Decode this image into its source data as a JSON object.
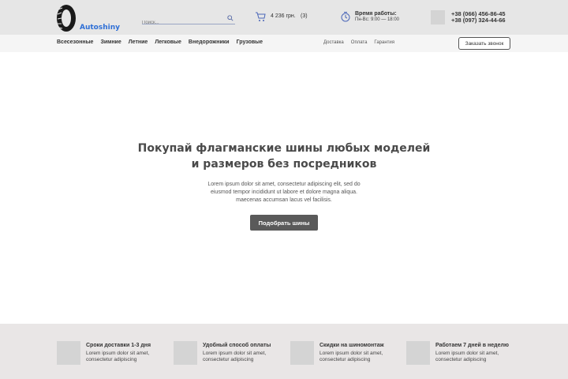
{
  "header": {
    "logo_text": "Autoshiny",
    "search_placeholder": "Поиск...",
    "cart_total": "4 236 грн.",
    "cart_count": "(3)",
    "hours_title": "Время работы:",
    "hours_value": "Пн-Вс: 9:00 — 18:00",
    "phone1": "+38 (066) 456-86-45",
    "phone2": "+38 (097) 324-44-66"
  },
  "nav": {
    "main": [
      "Всесезонные",
      "Зимние",
      "Летние",
      "Легковые",
      "Внедорожники",
      "Грузовые"
    ],
    "secondary": [
      "Доставка",
      "Оплата",
      "Гарантия"
    ],
    "callback_label": "Заказать звонок"
  },
  "hero": {
    "title_line1": "Покупай флагманские шины любых моделей",
    "title_line2": "и размеров  без посредников",
    "desc_line1": "Lorem ipsum dolor sit amet, consectetur adipiscing elit, sed do",
    "desc_line2": "eiusmod tempor incididunt ut labore et dolore magna aliqua.",
    "desc_line3": "maecenas accumsan lacus vel facilisis.",
    "button_label": "Подобрать шины"
  },
  "features": [
    {
      "title": "Сроки доставки 1-3 дня",
      "desc": "Lorem ipsum dolor sit amet, consectetur adipiscing"
    },
    {
      "title": "Удобный способ оплаты",
      "desc": "Lorem ipsum dolor sit amet, consectetur adipiscing"
    },
    {
      "title": "Скидки на шиномонтаж",
      "desc": "Lorem ipsum dolor sit amet, consectetur adipiscing"
    },
    {
      "title": "Работаем 7 дней в неделю",
      "desc": "Lorem ipsum dolor sit amet, consectetur adipiscing"
    }
  ],
  "colors": {
    "accent": "#2e6fd6",
    "button": "#5a5a5a"
  },
  "icons": [
    "tire-logo-icon",
    "search-icon",
    "cart-icon",
    "clock-icon"
  ]
}
